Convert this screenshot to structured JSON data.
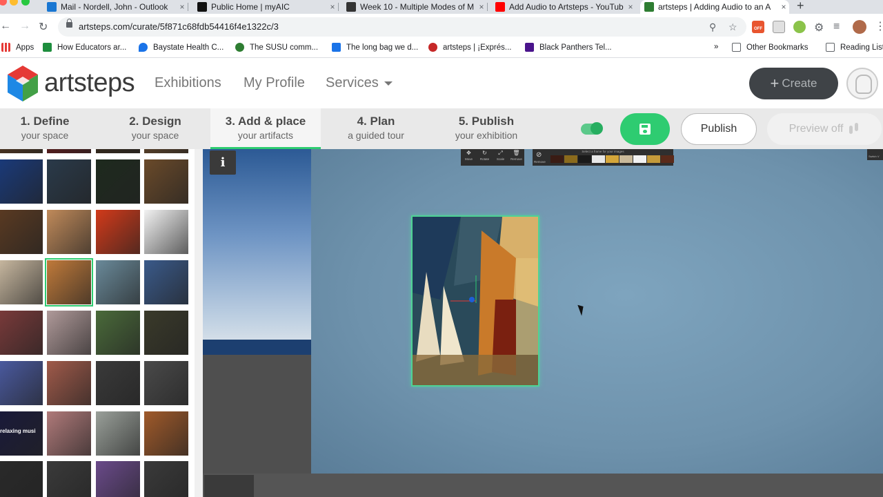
{
  "browser": {
    "tabs": [
      {
        "title": "Mail - Nordell, John - Outlook",
        "fav_color": "#1976d2",
        "active": false
      },
      {
        "title": "Public Home | myAIC",
        "fav_color": "#111111",
        "active": false
      },
      {
        "title": "Week 10 - Multiple Modes of M",
        "fav_color": "#333333",
        "active": false
      },
      {
        "title": "Add Audio to Artsteps - YouTub",
        "fav_color": "#ff0000",
        "active": false
      },
      {
        "title": "artsteps | Adding Audio to an A",
        "fav_color": "#2e7d32",
        "active": true
      }
    ],
    "close_glyph": "×",
    "new_tab_glyph": "+",
    "url": "artsteps.com/curate/5f871c68fdb54416f4e1322c/3",
    "extension_badge": "OFF",
    "bookmarks": [
      {
        "label": "Apps",
        "fav_color": "#4285f4"
      },
      {
        "label": "How Educators ar...",
        "fav_color": "#1e8e3e"
      },
      {
        "label": "Baystate Health C...",
        "fav_color": "#1a73e8"
      },
      {
        "label": "The SUSU comm...",
        "fav_color": "#2e7d32"
      },
      {
        "label": "The long bag we d...",
        "fav_color": "#1a73e8"
      },
      {
        "label": "artsteps | ¡Exprés...",
        "fav_color": "#c62828"
      },
      {
        "label": "Black Panthers Tel...",
        "fav_color": "#4a148c"
      }
    ],
    "bookmarks_overflow": "»",
    "other_bookmarks": "Other Bookmarks",
    "reading_list": "Reading List"
  },
  "app": {
    "logo_text": "artsteps",
    "nav": {
      "exhibitions": "Exhibitions",
      "my_profile": "My Profile",
      "services": "Services"
    },
    "create_label": "Create",
    "create_plus": "+",
    "steps": [
      {
        "num": "1. Define",
        "sub": "your space"
      },
      {
        "num": "2. Design",
        "sub": "your space"
      },
      {
        "num": "3. Add & place",
        "sub": "your artifacts"
      },
      {
        "num": "4. Plan",
        "sub": "a guided tour"
      },
      {
        "num": "5. Publish",
        "sub": "your exhibition"
      }
    ],
    "active_step": 3,
    "toggle_on": true,
    "publish_label": "Publish",
    "preview_label": "Preview off",
    "accent_color": "#2ecc71"
  },
  "viewer": {
    "info_glyph": "i",
    "tools": [
      {
        "label": "Move",
        "glyph": "✥"
      },
      {
        "label": "Rotate",
        "glyph": "↻"
      },
      {
        "label": "Scale",
        "glyph": "⤢"
      },
      {
        "label": "Remove",
        "glyph": "🗑"
      }
    ],
    "frames_header": "Select a frame for your images",
    "no_frame_label": "Remove",
    "frame_colors": [
      "#3a1c14",
      "#8a6a1c",
      "#1a1a1a",
      "#e8e8e8",
      "#d4a63a",
      "#c9b99a",
      "#f2f2f2",
      "#c49a3a",
      "#5a2a1a"
    ],
    "switch_label": "Switch V"
  },
  "artifacts": [
    [
      "#5a3a20",
      "#6a1a1a",
      "#3a2a1a",
      "#6a4a2a"
    ],
    [
      "#1a3a7a",
      "#2a3a4a",
      "#1e2a1e",
      "#6a4a2a"
    ],
    [
      "#5a3a22",
      "#c08a5a",
      "#d23a1a",
      "#f2f2f2"
    ],
    [
      "#c8b8a0",
      "#c07a3a",
      "#6a8a9a",
      "#3a5a8a"
    ],
    [
      "#7a3a3a",
      "#b09a9a",
      "#4a6a3a",
      "#3a3a2a"
    ],
    [
      "#4a5aa0",
      "#a05a4a",
      "#3a3a3a",
      "#4a4a4a"
    ],
    [
      "#1a1a3a",
      "#b07a7a",
      "#9aa09a",
      "#a05a2a"
    ],
    [
      "#2a2a2a",
      "#3a3a3a",
      "#6a4a8a",
      "#3a3a3a"
    ]
  ],
  "artifact_caption": "relaxing musi"
}
